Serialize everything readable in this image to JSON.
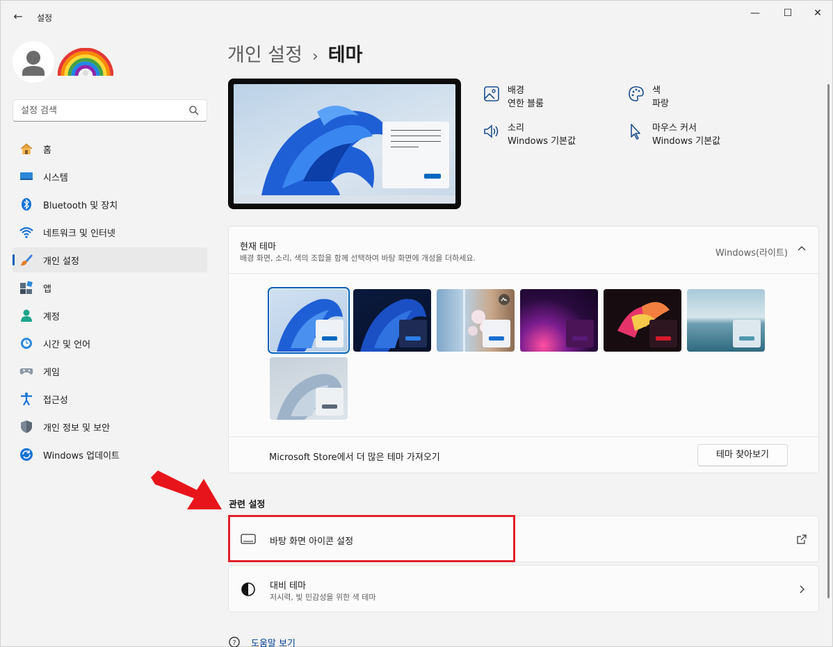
{
  "window": {
    "title": "설정",
    "back_glyph": "←",
    "minimize_glyph": "—",
    "maximize_glyph": "☐",
    "close_glyph": "✕"
  },
  "search": {
    "placeholder": "설정 검색",
    "icon": "search-icon"
  },
  "sidebar": {
    "items": [
      {
        "label": "홈",
        "icon": "home-icon"
      },
      {
        "label": "시스템",
        "icon": "system-icon"
      },
      {
        "label": "Bluetooth 및 장치",
        "icon": "bluetooth-icon"
      },
      {
        "label": "네트워크 및 인터넷",
        "icon": "wifi-icon"
      },
      {
        "label": "개인 설정",
        "icon": "brush-icon",
        "active": true
      },
      {
        "label": "앱",
        "icon": "apps-icon"
      },
      {
        "label": "계정",
        "icon": "account-icon"
      },
      {
        "label": "시간 및 언어",
        "icon": "clock-icon"
      },
      {
        "label": "게임",
        "icon": "gamepad-icon"
      },
      {
        "label": "접근성",
        "icon": "accessibility-icon"
      },
      {
        "label": "개인 정보 및 보안",
        "icon": "shield-icon"
      },
      {
        "label": "Windows 업데이트",
        "icon": "update-icon"
      }
    ]
  },
  "breadcrumb": {
    "parent": "개인 설정",
    "separator": "›",
    "current": "테마"
  },
  "theme_attributes": {
    "background": {
      "name": "배경",
      "value": "연한 블룸",
      "icon": "image-icon"
    },
    "color": {
      "name": "색",
      "value": "파랑",
      "icon": "palette-icon"
    },
    "sound": {
      "name": "소리",
      "value": "Windows 기본값",
      "icon": "speaker-icon"
    },
    "cursor": {
      "name": "마우스 커서",
      "value": "Windows 기본값",
      "icon": "cursor-icon"
    }
  },
  "current_theme": {
    "title": "현재 테마",
    "subtitle": "배경 화면, 소리, 색의 조합을 함께 선택하여 바탕 화면에 개성을 더하세요.",
    "value": "Windows(라이트)",
    "store_label": "Microsoft Store에서 더 많은 테마 가져오기",
    "browse_button": "테마 찾아보기",
    "selected_index": 0
  },
  "accent_colors": {
    "primary": "#005fb8",
    "highlight_box": "#e0212a",
    "arrow": "#e8141c"
  },
  "related": {
    "title": "관련 설정",
    "desktop_icons": {
      "label": "바탕 화면 아이콘 설정",
      "icon": "monitor-icon",
      "end_icon": "external-link-icon"
    },
    "contrast": {
      "label": "대비 테마",
      "sub": "저시력, 빛 민감성을 위한 색 테마",
      "icon": "contrast-icon",
      "end_icon": "chevron-right-icon"
    }
  },
  "help": {
    "label": "도움말 보기",
    "icon": "help-icon"
  }
}
